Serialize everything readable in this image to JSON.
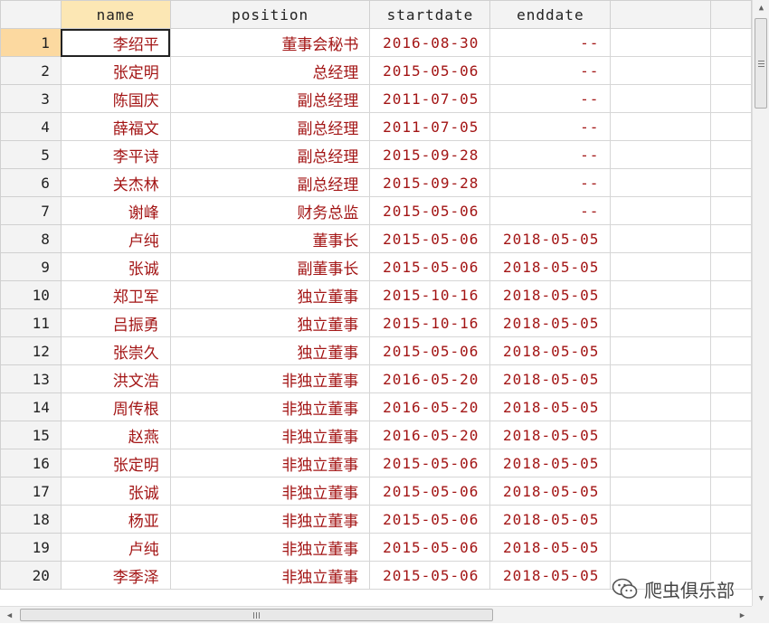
{
  "columns": {
    "rownum": "",
    "name": "name",
    "position": "position",
    "startdate": "startdate",
    "enddate": "enddate"
  },
  "rows": [
    {
      "n": "1",
      "name": "李绍平",
      "position": "董事会秘书",
      "startdate": "2016-08-30",
      "enddate": "--"
    },
    {
      "n": "2",
      "name": "张定明",
      "position": "总经理",
      "startdate": "2015-05-06",
      "enddate": "--"
    },
    {
      "n": "3",
      "name": "陈国庆",
      "position": "副总经理",
      "startdate": "2011-07-05",
      "enddate": "--"
    },
    {
      "n": "4",
      "name": "薛福文",
      "position": "副总经理",
      "startdate": "2011-07-05",
      "enddate": "--"
    },
    {
      "n": "5",
      "name": "李平诗",
      "position": "副总经理",
      "startdate": "2015-09-28",
      "enddate": "--"
    },
    {
      "n": "6",
      "name": "关杰林",
      "position": "副总经理",
      "startdate": "2015-09-28",
      "enddate": "--"
    },
    {
      "n": "7",
      "name": "谢峰",
      "position": "财务总监",
      "startdate": "2015-05-06",
      "enddate": "--"
    },
    {
      "n": "8",
      "name": "卢纯",
      "position": "董事长",
      "startdate": "2015-05-06",
      "enddate": "2018-05-05"
    },
    {
      "n": "9",
      "name": "张诚",
      "position": "副董事长",
      "startdate": "2015-05-06",
      "enddate": "2018-05-05"
    },
    {
      "n": "10",
      "name": "郑卫军",
      "position": "独立董事",
      "startdate": "2015-10-16",
      "enddate": "2018-05-05"
    },
    {
      "n": "11",
      "name": "吕振勇",
      "position": "独立董事",
      "startdate": "2015-10-16",
      "enddate": "2018-05-05"
    },
    {
      "n": "12",
      "name": "张崇久",
      "position": "独立董事",
      "startdate": "2015-05-06",
      "enddate": "2018-05-05"
    },
    {
      "n": "13",
      "name": "洪文浩",
      "position": "非独立董事",
      "startdate": "2016-05-20",
      "enddate": "2018-05-05"
    },
    {
      "n": "14",
      "name": "周传根",
      "position": "非独立董事",
      "startdate": "2016-05-20",
      "enddate": "2018-05-05"
    },
    {
      "n": "15",
      "name": "赵燕",
      "position": "非独立董事",
      "startdate": "2016-05-20",
      "enddate": "2018-05-05"
    },
    {
      "n": "16",
      "name": "张定明",
      "position": "非独立董事",
      "startdate": "2015-05-06",
      "enddate": "2018-05-05"
    },
    {
      "n": "17",
      "name": "张诚",
      "position": "非独立董事",
      "startdate": "2015-05-06",
      "enddate": "2018-05-05"
    },
    {
      "n": "18",
      "name": "杨亚",
      "position": "非独立董事",
      "startdate": "2015-05-06",
      "enddate": "2018-05-05"
    },
    {
      "n": "19",
      "name": "卢纯",
      "position": "非独立董事",
      "startdate": "2015-05-06",
      "enddate": "2018-05-05"
    },
    {
      "n": "20",
      "name": "李季泽",
      "position": "非独立董事",
      "startdate": "2015-05-06",
      "enddate": "2018-05-05"
    }
  ],
  "watermark": {
    "text": "爬虫俱乐部",
    "icon": "wechat-icon"
  },
  "colors": {
    "cell_text": "#a31515",
    "header_bg": "#f3f3f3",
    "selected_header_bg": "#fce7b4",
    "selected_rownum_bg": "#fcd9a0",
    "gridline": "#d6d6d6"
  }
}
